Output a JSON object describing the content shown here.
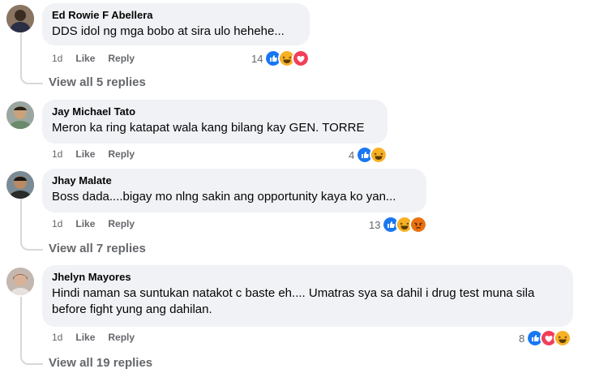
{
  "comments": [
    {
      "author": "Ed Rowie F Abellera",
      "text": "DDS idol ng mga bobo at sira ulo hehehe...",
      "time": "1d",
      "like": "Like",
      "reply": "Reply",
      "reaction_count": "14",
      "reactions": [
        "like",
        "haha",
        "love"
      ],
      "view_replies": "View all 5 replies"
    },
    {
      "author": "Jay Michael Tato",
      "text": "Meron ka ring katapat wala kang bilang kay GEN. TORRE",
      "time": "1d",
      "like": "Like",
      "reply": "Reply",
      "reaction_count": "4",
      "reactions": [
        "like",
        "haha"
      ]
    },
    {
      "author": "Jhay Malate",
      "text": "Boss dada....bigay mo nlng sakin ang opportunity kaya ko yan...",
      "time": "1d",
      "like": "Like",
      "reply": "Reply",
      "reaction_count": "13",
      "reactions": [
        "like",
        "haha",
        "angry"
      ],
      "view_replies": "View all 7 replies"
    },
    {
      "author": "Jhelyn Mayores",
      "text_line1": "Hindi naman sa suntukan natakot c baste eh.... Umatras sya sa dahil i drug test muna sila",
      "text_line2": "before fight yung ang dahilan.",
      "time": "1d",
      "like": "Like",
      "reply": "Reply",
      "reaction_count": "8",
      "reactions": [
        "like",
        "love",
        "haha"
      ],
      "view_replies": "View all 19 replies"
    }
  ],
  "colors": {
    "bubble": "#f0f2f5",
    "meta_text": "#65676b",
    "like_blue": "#1877f2",
    "love_red": "#f33e58",
    "haha_yellow": "#f7b125",
    "angry_orange": "#e9710f"
  }
}
